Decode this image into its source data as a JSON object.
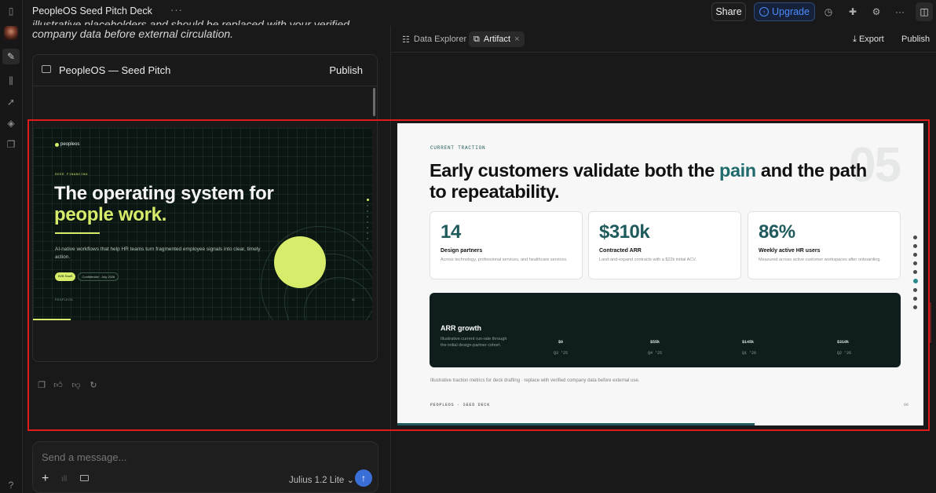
{
  "app": {
    "title": "PeopleOS Seed Pitch Deck",
    "share_label": "Share",
    "upgrade_label": "Upgrade"
  },
  "chat": {
    "partial_line": "illustrative placeholders and should be replaced with your verified",
    "line2": "company data before external circulation."
  },
  "artifact_card": {
    "title": "PeopleOS — Seed Pitch",
    "publish_label": "Publish"
  },
  "slide1": {
    "logo": "peopleos",
    "kicker": "SEED FINANCING",
    "headline_a": "The operating system for",
    "headline_b": "people work.",
    "body": "AI-native workflows that help HR teams turn fragmented employee signals into clear, timely action.",
    "tag1": "B2B SaaS",
    "tag2": "Confidential · July 2026",
    "footer": "PEOPLEOS",
    "page": "01"
  },
  "composer": {
    "placeholder": "Send a message...",
    "model": "Julius 1.2 Lite"
  },
  "right_panel": {
    "tab1": "Data Explorer",
    "tab2": "Artifact",
    "export_label": "Export",
    "publish_label": "Publish"
  },
  "slide2": {
    "kicker": "CURRENT TRACTION",
    "headline_a": "Early customers validate both the ",
    "headline_hl": "pain",
    "headline_b": " and the path to repeatability.",
    "big_number": "05",
    "cards": [
      {
        "value": "14",
        "label": "Design partners",
        "desc": "Across technology, professional services, and healthcare services."
      },
      {
        "value": "$310k",
        "label": "Contracted ARR",
        "desc": "Land-and-expand contracts with a $22k initial ACV."
      },
      {
        "value": "86%",
        "label": "Weekly active HR users",
        "desc": "Measured across active customer workspaces after onboarding."
      }
    ],
    "arr": {
      "title": "ARR growth",
      "desc": "Illustrative current run-rate through the initial design-partner cohort.",
      "points": [
        {
          "value": "$0",
          "quarter": "Q3 '25"
        },
        {
          "value": "$55k",
          "quarter": "Q4 '25"
        },
        {
          "value": "$145k",
          "quarter": "Q1 '26"
        },
        {
          "value": "$310k",
          "quarter": "Q2 '26"
        }
      ]
    },
    "note": "Illustrative traction metrics for deck drafting · replace with verified company data before external use.",
    "footer": "PEOPLEOS · SEED DECK",
    "page": "06"
  },
  "colors": {
    "accent_lime": "#d6ec6a",
    "accent_teal": "#1f5a5c",
    "upgrade_blue": "#4d8cff",
    "highlight_box": "#e01b1b"
  }
}
